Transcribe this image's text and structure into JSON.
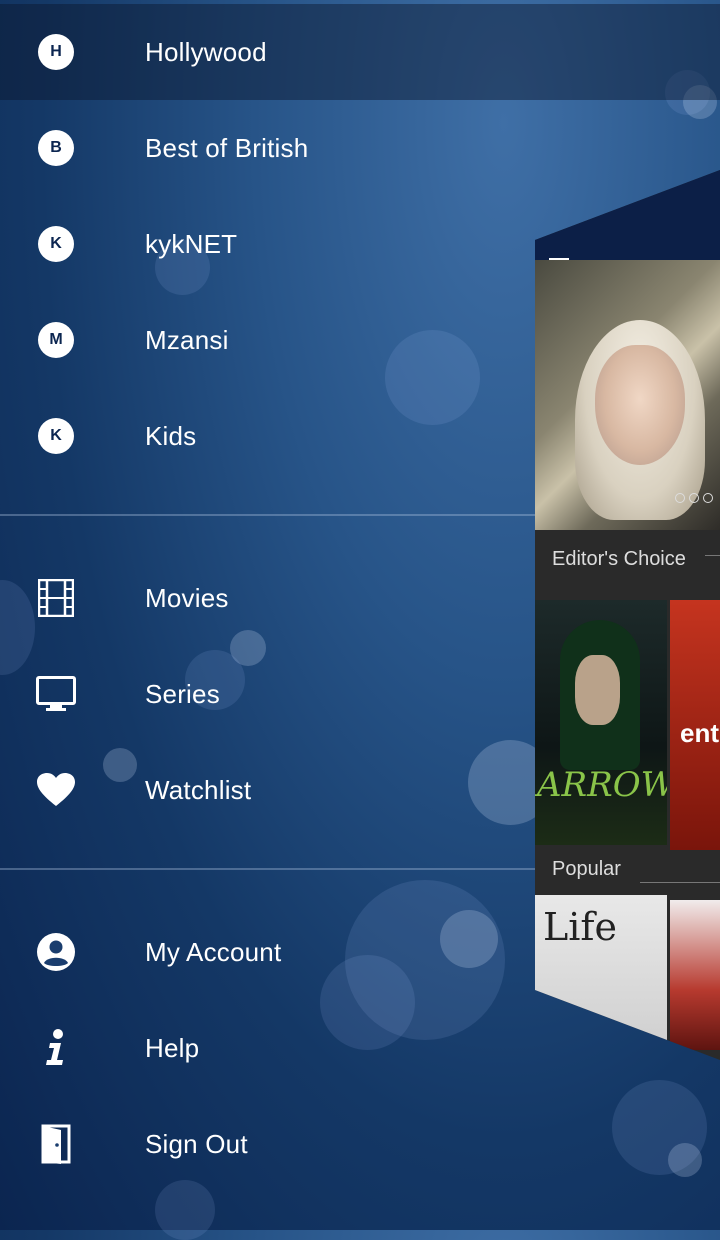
{
  "menu": {
    "channels": [
      {
        "badge": "H",
        "label": "Hollywood",
        "active": true
      },
      {
        "badge": "B",
        "label": "Best of British"
      },
      {
        "badge": "K",
        "label": "kykNET"
      },
      {
        "badge": "M",
        "label": "Mzansi"
      },
      {
        "badge": "K",
        "label": "Kids"
      }
    ],
    "library": [
      {
        "icon": "film-icon",
        "label": "Movies"
      },
      {
        "icon": "tv-icon",
        "label": "Series"
      },
      {
        "icon": "heart-icon",
        "label": "Watchlist"
      }
    ],
    "account": [
      {
        "icon": "account-icon",
        "label": "My Account"
      },
      {
        "icon": "info-icon",
        "label": "Help"
      },
      {
        "icon": "door-icon",
        "label": "Sign Out"
      }
    ]
  },
  "preview": {
    "section1": "Editor's Choice",
    "section2": "Popular",
    "tile1": "ARROW",
    "tile2": "ent",
    "tile3": "Life"
  },
  "colors": {
    "accent": "#0c1f47",
    "arrow_green": "#8ac449"
  }
}
